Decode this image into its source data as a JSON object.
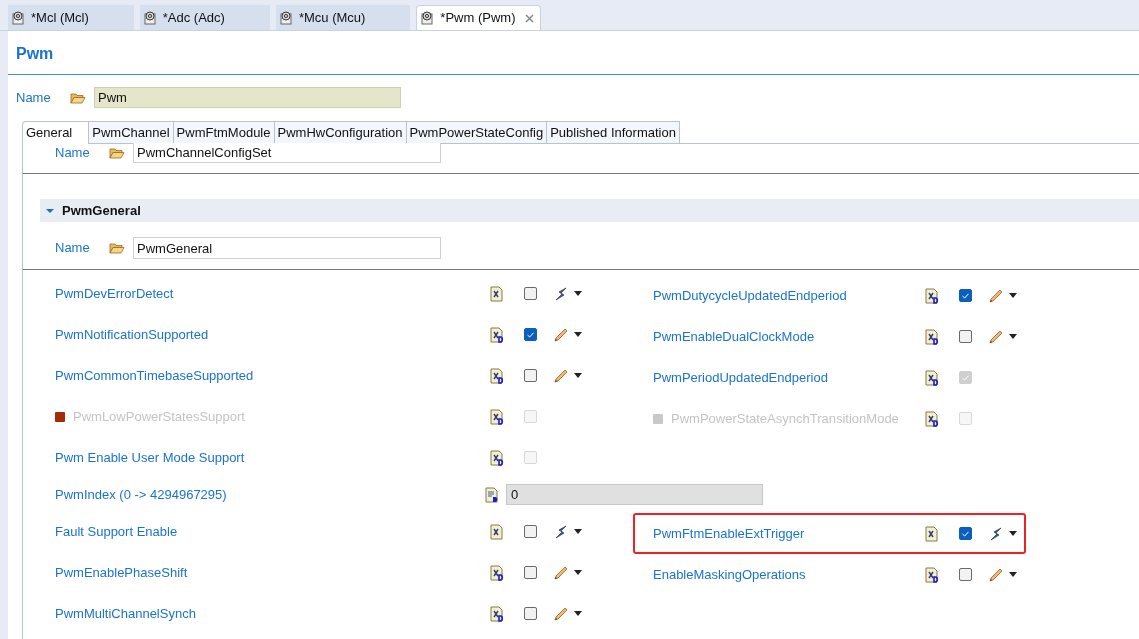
{
  "editor_tabs": [
    {
      "label": "*Mcl (Mcl)",
      "selected": false
    },
    {
      "label": "*Adc (Adc)",
      "selected": false
    },
    {
      "label": "*Mcu (Mcu)",
      "selected": false
    },
    {
      "label": "*Pwm (Pwm)",
      "selected": true
    }
  ],
  "page_title": "Pwm",
  "name_field": {
    "label": "Name",
    "value": "Pwm"
  },
  "config_tabs": [
    {
      "label": "General",
      "selected": true
    },
    {
      "label": "PwmChannel",
      "selected": false
    },
    {
      "label": "PwmFtmModule",
      "selected": false
    },
    {
      "label": "PwmHwConfiguration",
      "selected": false
    },
    {
      "label": "PwmPowerStateConfig",
      "selected": false
    },
    {
      "label": "Published Information",
      "selected": false
    }
  ],
  "config_name": {
    "label": "Name",
    "value": "PwmChannelConfigSet"
  },
  "section": {
    "title": "PwmGeneral",
    "expanded": true,
    "name_label": "Name",
    "name_value": "PwmGeneral"
  },
  "rows": [
    {
      "left": {
        "label": "PwmDevErrorDetect",
        "kind": "checkbox",
        "variant_aware": false,
        "checked": false,
        "disabled": false,
        "greyed": false,
        "has_menu": true,
        "manual": false
      },
      "right": {
        "label": "PwmDutycycleUpdatedEndperiod",
        "kind": "checkbox",
        "variant_aware": true,
        "checked": true,
        "disabled": false,
        "greyed": false,
        "has_menu": true,
        "manual": true,
        "highlighted": false
      }
    },
    {
      "left": {
        "label": "PwmNotificationSupported",
        "kind": "checkbox",
        "variant_aware": true,
        "checked": true,
        "disabled": false,
        "greyed": false,
        "has_menu": true,
        "manual": true
      },
      "right": {
        "label": "PwmEnableDualClockMode",
        "kind": "checkbox",
        "variant_aware": true,
        "checked": false,
        "disabled": false,
        "greyed": false,
        "has_menu": true,
        "manual": true,
        "highlighted": false
      }
    },
    {
      "left": {
        "label": "PwmCommonTimebaseSupported",
        "kind": "checkbox",
        "variant_aware": true,
        "checked": false,
        "disabled": false,
        "greyed": false,
        "has_menu": true,
        "manual": true
      },
      "right": {
        "label": "PwmPeriodUpdatedEndperiod",
        "kind": "checkbox",
        "variant_aware": true,
        "checked": true,
        "disabled": true,
        "greyed": false,
        "has_menu": false,
        "highlighted": false
      }
    },
    {
      "left": {
        "label": "PwmLowPowerStatesSupport",
        "kind": "checkbox",
        "variant_aware": true,
        "checked": false,
        "disabled": true,
        "greyed": true,
        "color": "#a52a0a",
        "has_menu": false
      },
      "right": {
        "label": "PwmPowerStateAsynchTransitionMode",
        "kind": "checkbox",
        "variant_aware": true,
        "checked": false,
        "disabled": true,
        "greyed": true,
        "color": "#c8c8c8",
        "has_menu": false,
        "highlighted": false
      }
    },
    {
      "left": {
        "label": "Pwm Enable User Mode Support",
        "kind": "checkbox",
        "variant_aware": true,
        "checked": false,
        "disabled": true,
        "greyed": false,
        "has_menu": false
      }
    },
    {
      "left": {
        "label": "PwmIndex (0 -> 4294967295)",
        "kind": "number",
        "value": "0",
        "disabled": true,
        "greyed": false
      }
    },
    {
      "left": {
        "label": "Fault Support Enable",
        "kind": "checkbox",
        "variant_aware": false,
        "checked": false,
        "disabled": false,
        "greyed": false,
        "has_menu": true,
        "manual": false
      },
      "right": {
        "label": "PwmFtmEnableExtTrigger",
        "kind": "checkbox",
        "variant_aware": false,
        "checked": true,
        "disabled": false,
        "greyed": false,
        "has_menu": true,
        "manual": false,
        "highlighted": true
      }
    },
    {
      "left": {
        "label": "PwmEnablePhaseShift",
        "kind": "checkbox",
        "variant_aware": true,
        "checked": false,
        "disabled": false,
        "greyed": false,
        "has_menu": true,
        "manual": true
      },
      "right": {
        "label": "EnableMaskingOperations",
        "kind": "checkbox",
        "variant_aware": true,
        "checked": false,
        "disabled": false,
        "greyed": false,
        "has_menu": true,
        "manual": true,
        "highlighted": false
      }
    },
    {
      "left": {
        "label": "PwmMultiChannelSynch",
        "kind": "checkbox",
        "variant_aware": true,
        "checked": false,
        "disabled": false,
        "greyed": false,
        "has_menu": true,
        "manual": true
      }
    }
  ]
}
